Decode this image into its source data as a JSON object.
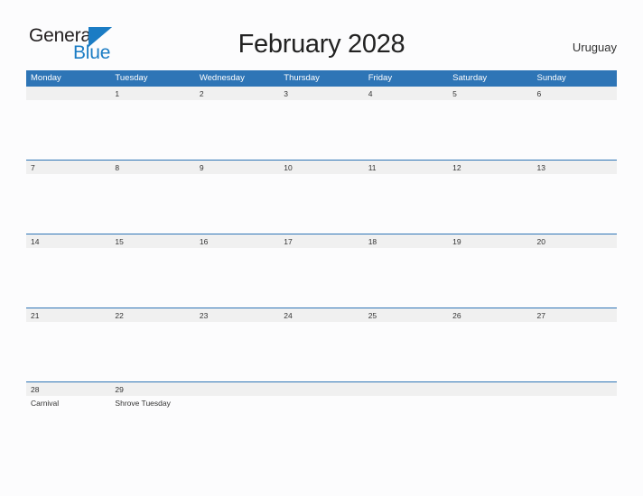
{
  "brand": {
    "word_one": "General",
    "word_two": "Blue",
    "triangle_icon": "triangle-logo-icon",
    "color_text": "#231f20",
    "color_blue": "#1b7cc4"
  },
  "header": {
    "title": "February 2028",
    "country": "Uruguay"
  },
  "theme": {
    "header_blue": "#2e75b6",
    "row_line_blue": "#2e75b6",
    "day_band_gray": "#f0f0f0",
    "page_background": "#fcfcfd",
    "text_dark": "#333333"
  },
  "calendar": {
    "weekday_headers": [
      "Monday",
      "Tuesday",
      "Wednesday",
      "Thursday",
      "Friday",
      "Saturday",
      "Sunday"
    ],
    "weeks": [
      {
        "days": [
          {
            "number": "",
            "events": []
          },
          {
            "number": "1",
            "events": []
          },
          {
            "number": "2",
            "events": []
          },
          {
            "number": "3",
            "events": []
          },
          {
            "number": "4",
            "events": []
          },
          {
            "number": "5",
            "events": []
          },
          {
            "number": "6",
            "events": []
          }
        ]
      },
      {
        "days": [
          {
            "number": "7",
            "events": []
          },
          {
            "number": "8",
            "events": []
          },
          {
            "number": "9",
            "events": []
          },
          {
            "number": "10",
            "events": []
          },
          {
            "number": "11",
            "events": []
          },
          {
            "number": "12",
            "events": []
          },
          {
            "number": "13",
            "events": []
          }
        ]
      },
      {
        "days": [
          {
            "number": "14",
            "events": []
          },
          {
            "number": "15",
            "events": []
          },
          {
            "number": "16",
            "events": []
          },
          {
            "number": "17",
            "events": []
          },
          {
            "number": "18",
            "events": []
          },
          {
            "number": "19",
            "events": []
          },
          {
            "number": "20",
            "events": []
          }
        ]
      },
      {
        "days": [
          {
            "number": "21",
            "events": []
          },
          {
            "number": "22",
            "events": []
          },
          {
            "number": "23",
            "events": []
          },
          {
            "number": "24",
            "events": []
          },
          {
            "number": "25",
            "events": []
          },
          {
            "number": "26",
            "events": []
          },
          {
            "number": "27",
            "events": []
          }
        ]
      },
      {
        "days": [
          {
            "number": "28",
            "events": [
              "Carnival"
            ]
          },
          {
            "number": "29",
            "events": [
              "Shrove Tuesday"
            ]
          },
          {
            "number": "",
            "events": []
          },
          {
            "number": "",
            "events": []
          },
          {
            "number": "",
            "events": []
          },
          {
            "number": "",
            "events": []
          },
          {
            "number": "",
            "events": []
          }
        ]
      }
    ]
  }
}
